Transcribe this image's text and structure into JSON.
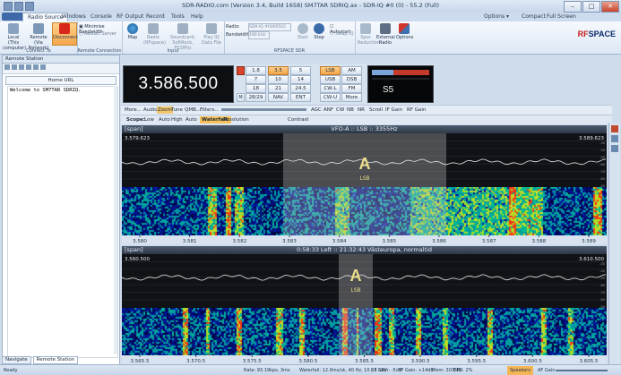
{
  "window": {
    "title": "SDR-RADIO.com (Version 3.4, Build 1658) SM7TAR SDRIQ.ax - SDR-IQ #0 (0) - 55.2 (Full)"
  },
  "tabs": [
    "Home",
    "Radio Source",
    "Windows",
    "Console",
    "RF Output",
    "Record",
    "Tools",
    "Help"
  ],
  "tabs_right": {
    "options": "Options ▾",
    "compact": "Compact",
    "fullscreen": "Full Screen"
  },
  "ribbon": {
    "connect": {
      "local": "Local (This computer)",
      "remote": "Remote (Via Network)",
      "disconnect": "Disconnect",
      "group": "Connect To"
    },
    "remote_conn": {
      "min_bw": "Minimise Bandwidth",
      "restart": "Restart Server",
      "group": "Remote Connection"
    },
    "input": {
      "map": "Map",
      "radio": "Radio (RFspace)",
      "soundcard": "Soundcard, SoftRock, FCDPro",
      "playiq": "Play IQ Data File",
      "group": "Input"
    },
    "rfspace": {
      "radio_label": "Radio:",
      "radio_value": "SDR-IQ #0000502",
      "bandwidth_label": "Bandwidth:",
      "bandwidth_value": "190 kHz",
      "start": "Start",
      "stop": "Stop",
      "autostart": "Autostart",
      "swap_iq": "Swap IQ",
      "group": "RFSPACE SDR"
    },
    "other": {
      "spur": "Spur Reduction",
      "external": "External Radio",
      "options": "Options"
    }
  },
  "brand": {
    "rf": "RF",
    "space": "SPACE"
  },
  "left_panel": {
    "title": "Remote Station",
    "home_url": "Home URL",
    "console_text": "Welcome to SM7TAR SDRIQ.",
    "tab_navigate": "Navigate",
    "tab_remote": "Remote Station"
  },
  "frequency": "3.586.500",
  "band_buttons": [
    "1.8",
    "3.5",
    "5",
    "7",
    "10",
    "14",
    "18",
    "21",
    "24.5",
    "28/29",
    "NAV",
    "ENT"
  ],
  "band_active": "3.5",
  "mode_buttons": [
    "LSB",
    "AM",
    "USB",
    "DSB",
    "CW-L",
    "FM",
    "CW-U",
    "More"
  ],
  "mode_active": "LSB",
  "smeter_text": "S5",
  "toolbar_items": [
    "More...",
    "Audio",
    "Zoom",
    "Tune",
    "QMB...",
    "Filters...",
    "AGC",
    "ANF",
    "CW",
    "NB",
    "NR",
    "Scroll",
    "IF Gain",
    "RF Gain"
  ],
  "scope_items": {
    "scope": "Scope:",
    "low": "Low",
    "auto1": "Auto",
    "high": "High",
    "auto2": "Auto",
    "waterfall": "Waterfall:",
    "resolution": "Resolution",
    "contrast": "Contrast"
  },
  "vfo": {
    "span_tag": "[span]",
    "title": "VFO-A  ::  LSB  ::  3355Hz",
    "left_freq": "3.579.623",
    "right_freq": "3.589.623",
    "marker": "A",
    "marker_mode": "LSB",
    "ticks": [
      "3.580",
      "3.581",
      "3.582",
      "3.583",
      "3.584",
      "3.585",
      "3.586",
      "3.587",
      "3.588",
      "3.589"
    ],
    "dbscale": [
      "-30",
      "-40",
      "-50",
      "-60",
      "-70",
      "-80",
      "-90"
    ]
  },
  "wide": {
    "span_tag": "[span]",
    "title": "0:58:33 Left  ::  21:32:43 Västeuropa, normaltid",
    "left_freq": "3.560.500",
    "right_freq": "3.610.500",
    "marker": "A",
    "marker_mode": "LSB",
    "ticks": [
      "3.565.5",
      "3.570.5",
      "3.575.5",
      "3.580.5",
      "3.585.5",
      "3.590.5",
      "3.595.5",
      "3.600.5",
      "3.605.5"
    ],
    "dbscale": [
      "-30",
      "-40",
      "-50",
      "-60",
      "-70",
      "-80",
      "-90"
    ]
  },
  "status": {
    "ready": "Ready",
    "rate": "Rate: 93.19kps, 3ms",
    "waterfall": "Waterfall: 12.9ms/sk, 40 Hz, 10 | 3 SRV",
    "rfgain": "RF Gain: -5dB",
    "ifgain": "IF Gain: +14dB",
    "mem": "Mem: 303MB",
    "cpu": "CPU: 2%",
    "speakers": "Speakers",
    "afgain": "AF Gain"
  }
}
